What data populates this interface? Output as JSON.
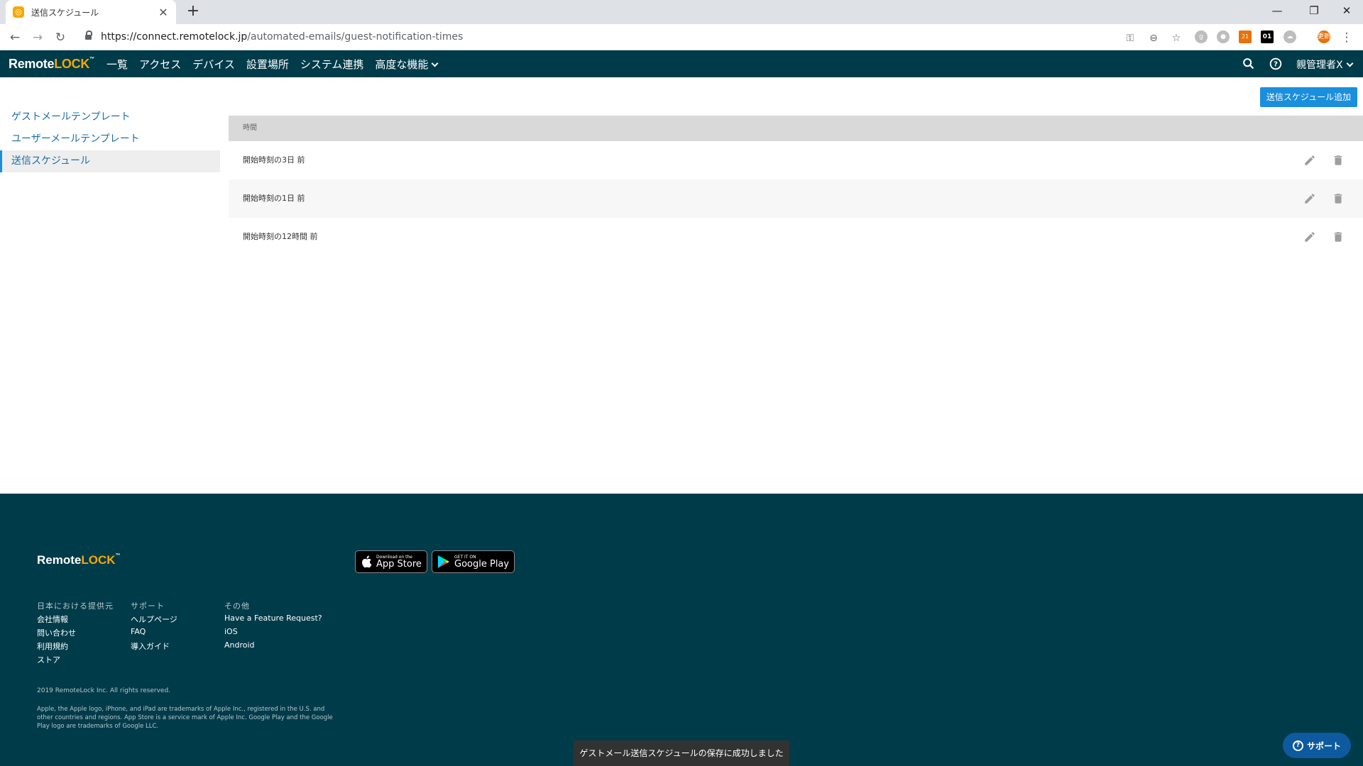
{
  "browser": {
    "tab_title": "送信スケジュール",
    "url_host": "https://connect.remotelock.jp",
    "url_path": "/automated-emails/guest-notification-times",
    "ext_badge_count": "21",
    "ext_binary_label": "01",
    "profile_label": "更新"
  },
  "header": {
    "logo_left": "Remote",
    "logo_highlight": "LOCK",
    "nav": [
      "一覧",
      "アクセス",
      "デバイス",
      "設置場所",
      "システム連携",
      "高度な機能"
    ],
    "user_label": "親管理者X"
  },
  "page": {
    "add_button_label": "送信スケジュール追加",
    "sidebar": [
      {
        "label": "ゲストメールテンプレート",
        "active": false
      },
      {
        "label": "ユーザーメールテンプレート",
        "active": false
      },
      {
        "label": "送信スケジュール",
        "active": true
      }
    ],
    "table": {
      "header": "時間",
      "rows": [
        "開始時刻の3日 前",
        "開始時刻の1日 前",
        "開始時刻の12時間 前"
      ]
    }
  },
  "footer": {
    "logo_left": "Remote",
    "logo_highlight": "LOCK",
    "app_store_small": "Download on the",
    "app_store_big": "App Store",
    "google_play_small": "GET IT ON",
    "google_play_big": "Google Play",
    "columns": [
      {
        "heading": "日本における提供元",
        "links": [
          "会社情報",
          "問い合わせ",
          "利用規約",
          "ストア"
        ]
      },
      {
        "heading": "サポート",
        "links": [
          "ヘルプページ",
          "FAQ",
          "導入ガイド"
        ]
      },
      {
        "heading": "その他",
        "links": [
          "Have a Feature Request?",
          "iOS",
          "Android"
        ]
      }
    ],
    "copyright": "2019 RemoteLock Inc. All rights reserved.",
    "disclaimer": "Apple, the Apple logo, iPhone, and iPad are trademarks of Apple Inc., registered in the U.S. and other countries and regions. App Store is a service mark of Apple Inc. Google Play and the Google Play logo are trademarks of Google LLC."
  },
  "toast": "ゲストメール送信スケジュールの保存に成功しました",
  "support_label": "サポート",
  "colors": {
    "header_bg": "#003b4a",
    "accent_blue": "#1a8fdd",
    "logo_yellow": "#f6a800"
  }
}
